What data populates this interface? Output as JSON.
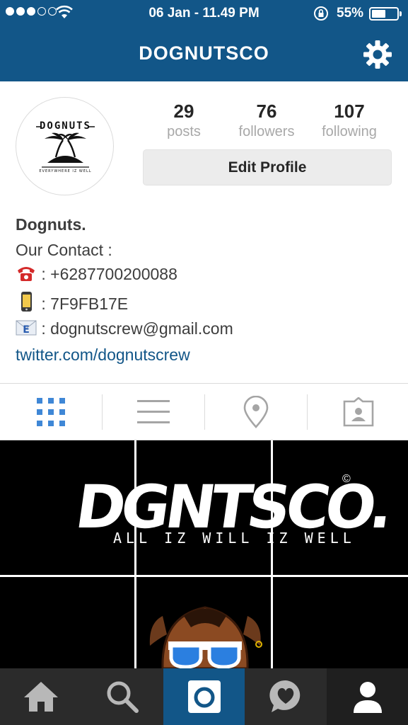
{
  "status_bar": {
    "time": "06 Jan - 11.49 PM",
    "battery_percent": "55%",
    "battery_level": 0.55,
    "signal_bars_filled": 3,
    "signal_bars_total": 5
  },
  "header": {
    "title": "DOGNUTSCO",
    "bg_color": "#125688"
  },
  "profile": {
    "avatar_logo_text": "DOGNUTS",
    "avatar_logo_tagline": "EVERYWHERE IZ WELL",
    "stats": [
      {
        "value": "29",
        "label": "posts"
      },
      {
        "value": "76",
        "label": "followers"
      },
      {
        "value": "107",
        "label": "following"
      }
    ],
    "edit_profile_label": "Edit Profile"
  },
  "bio": {
    "name": "Dognuts.",
    "contact_heading": "Our Contact :",
    "phone_line": ": +6287700200088",
    "pin_line": ": 7F9FB17E",
    "email_line": ": dognutscrew@gmail.com",
    "email_badge": "E",
    "link": "twitter.com/dognutscrew"
  },
  "tabs": [
    {
      "name": "grid-view",
      "icon": "grid-icon",
      "active": true
    },
    {
      "name": "list-view",
      "icon": "list-icon",
      "active": false
    },
    {
      "name": "places",
      "icon": "location-pin-icon",
      "active": false
    },
    {
      "name": "tagged",
      "icon": "tagged-photos-icon",
      "active": false
    }
  ],
  "posts": {
    "banner_text": "DGNTSCO.",
    "banner_tagline": "ALL IZ WILL IZ WELL",
    "copyright_mark": "©"
  },
  "bottom_nav": [
    {
      "name": "home",
      "icon": "home-icon"
    },
    {
      "name": "search",
      "icon": "search-icon"
    },
    {
      "name": "camera",
      "icon": "camera-icon",
      "active": true
    },
    {
      "name": "activity",
      "icon": "heart-bubble-icon"
    },
    {
      "name": "profile",
      "icon": "profile-icon",
      "active": true
    }
  ],
  "colors": {
    "accent": "#125688",
    "active_tab": "#3f87d6",
    "inactive_tab": "#a5a5a5"
  }
}
